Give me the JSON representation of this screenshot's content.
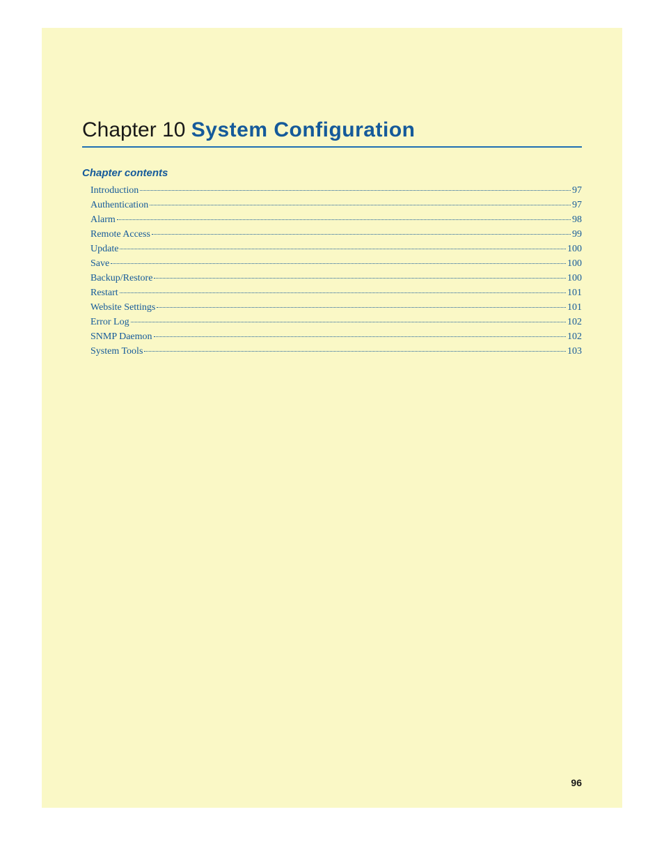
{
  "chapter": {
    "prefix": "Chapter 10 ",
    "title": "System Configuration"
  },
  "contents_heading": "Chapter contents",
  "toc": [
    {
      "label": "Introduction",
      "page": "97"
    },
    {
      "label": "Authentication",
      "page": "97"
    },
    {
      "label": "Alarm",
      "page": "98"
    },
    {
      "label": "Remote Access",
      "page": "99"
    },
    {
      "label": "Update",
      "page": "100"
    },
    {
      "label": "Save",
      "page": "100"
    },
    {
      "label": "Backup/Restore",
      "page": "100"
    },
    {
      "label": "Restart",
      "page": "101"
    },
    {
      "label": "Website Settings",
      "page": "101"
    },
    {
      "label": "Error Log",
      "page": "102"
    },
    {
      "label": "SNMP Daemon",
      "page": "102"
    },
    {
      "label": "System Tools",
      "page": "103"
    }
  ],
  "page_number": "96"
}
